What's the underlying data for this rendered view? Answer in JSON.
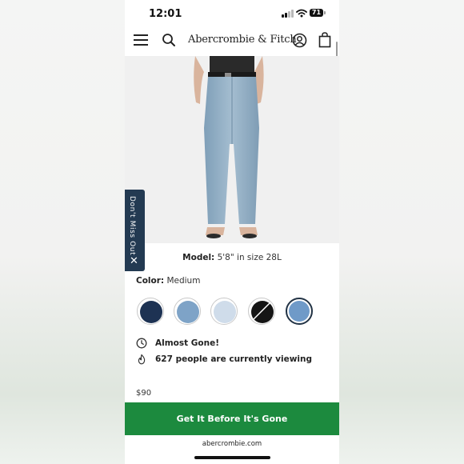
{
  "status_bar": {
    "time": "12:01",
    "battery": "71",
    "signal_icon": "cellular-signal-icon",
    "wifi_icon": "wifi-icon"
  },
  "header": {
    "brand": "Abercrombie & Fitch",
    "icons": [
      "menu-icon",
      "search-icon",
      "account-icon",
      "shopping-bag-icon"
    ]
  },
  "side_tab": {
    "label": "Don't Miss Out",
    "close": "✕"
  },
  "product": {
    "model_label": "Model:",
    "model_value": "5'8\" in size 28L",
    "color_label": "Color:",
    "color_value": "Medium",
    "swatches": [
      {
        "color": "#1d3253",
        "selected": false
      },
      {
        "color": "#7ea3c7",
        "selected": false
      },
      {
        "color": "#cfdcea",
        "selected": false
      },
      {
        "color": "#151515",
        "selected": false
      },
      {
        "color": "#6f9ac8",
        "selected": true
      }
    ],
    "notice_almost_gone": "Almost Gone!",
    "notice_viewers": "627 people are currently viewing",
    "price": "$90"
  },
  "cta": {
    "label": "Get It Before It's Gone",
    "color": "#1c8a3e"
  },
  "browser": {
    "url": "abercrombie.com"
  }
}
